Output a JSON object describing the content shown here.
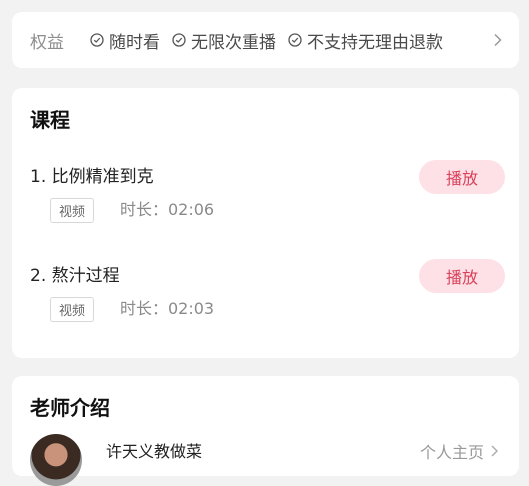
{
  "benefits": {
    "label": "权益",
    "items": [
      {
        "label": "随时看",
        "icon": "check-circle-icon"
      },
      {
        "label": "无限次重播",
        "icon": "check-circle-icon"
      },
      {
        "label": "不支持无理由退款",
        "icon": "check-circle-icon"
      }
    ],
    "more_icon": "chevron-right-icon"
  },
  "course": {
    "title": "课程",
    "lessons": [
      {
        "title": "1. 比例精准到克",
        "tag": "视频",
        "duration": "时长：02:06",
        "play_label": "播放"
      },
      {
        "title": "2. 熬汁过程",
        "tag": "视频",
        "duration": "时长：02:03",
        "play_label": "播放"
      }
    ]
  },
  "teacher": {
    "title": "老师介绍",
    "name": "许天义教做菜",
    "profile_link": "个人主页"
  },
  "colors": {
    "accent": "#d9415a",
    "play_bg": "#fde1e6",
    "background": "#f2f2f2"
  }
}
